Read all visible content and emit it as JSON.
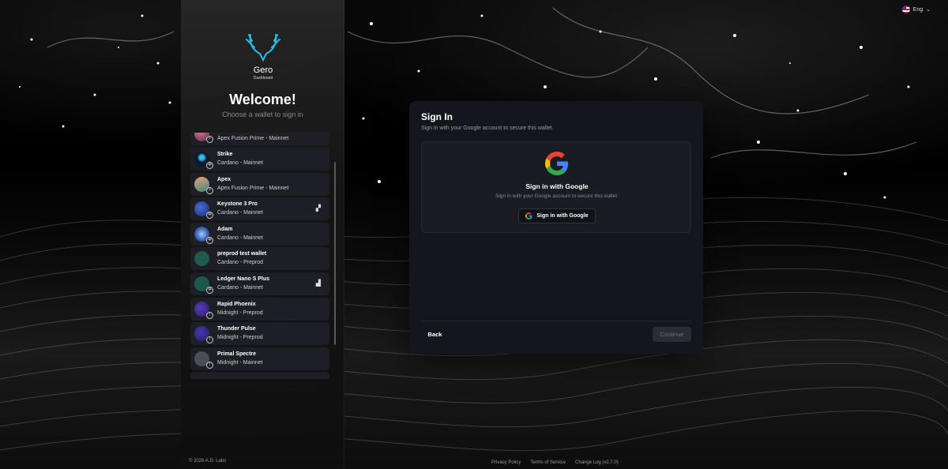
{
  "sidebar": {
    "brand_name": "Gero",
    "brand_tagline": "Dashboard",
    "welcome": "Welcome!",
    "subtitle": "Choose a wallet to sign in",
    "wallets": [
      {
        "name": "",
        "network": "Apex Fusion Prime - Mainnet",
        "avatar": "#7a4a6a",
        "badge": "apex-icon"
      },
      {
        "name": "Strike",
        "network": "Cardano - Mainnet",
        "avatar": "#0b1a2a",
        "badge": "cardano-icon"
      },
      {
        "name": "Apex",
        "network": "Apex Fusion Prime - Mainnet",
        "avatar": "#c98a6a",
        "badge": "apex-icon"
      },
      {
        "name": "Keystone 3 Pro",
        "network": "Cardano - Mainnet",
        "avatar": "#2a3a8a",
        "badge": "cardano-icon",
        "hw": "keystone-icon"
      },
      {
        "name": "Adam",
        "network": "Cardano - Mainnet",
        "avatar": "#3a5aaa",
        "badge": "cardano-icon"
      },
      {
        "name": "preprod test wallet",
        "network": "Cardano - Preprod",
        "avatar": "#1f5a4a",
        "badge": ""
      },
      {
        "name": "Ledger Nano S Plus",
        "network": "Cardano - Mainnet",
        "avatar": "#1a5a4a",
        "badge": "cardano-icon",
        "hw": "ledger-icon"
      },
      {
        "name": "Rapid Phoenix",
        "network": "Midnight - Preprod",
        "avatar": "#4a2a9a",
        "badge": "midnight-icon"
      },
      {
        "name": "Thunder Pulse",
        "network": "Midnight - Preprod",
        "avatar": "#3a2a8a",
        "badge": "midnight-icon"
      },
      {
        "name": "Primal Spectre",
        "network": "Midnight - Mainnet",
        "avatar": "#4a4f55",
        "badge": "midnight-icon"
      }
    ],
    "copyright": "© 2026 A.D. Labs"
  },
  "lang": {
    "label": "Eng"
  },
  "signin": {
    "title": "Sign In",
    "subtitle": "Sign in with your Google account to secure this wallet.",
    "inner_title": "Sign in with Google",
    "inner_subtitle": "Sign in with your Google account to secure this wallet.",
    "google_button": "Sign in with Google",
    "back": "Back",
    "continue": "Continue"
  },
  "footer": {
    "privacy": "Privacy Policy",
    "terms": "Terms of Service",
    "changelog": "Change Log (v2.7.0)"
  }
}
